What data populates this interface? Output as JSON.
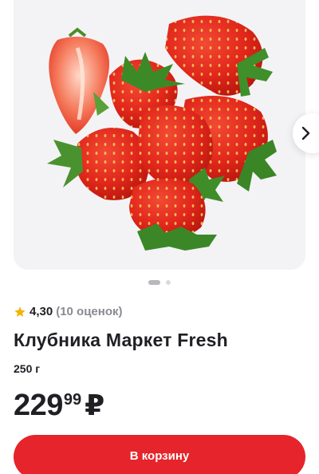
{
  "product": {
    "rating_value": "4,30",
    "rating_count": "(10 оценок)",
    "title": "Клубника Маркет Fresh",
    "weight": "250 г",
    "price_integer": "229",
    "price_fraction": "99",
    "currency": "₽"
  },
  "gallery": {
    "image": "strawberries-photo",
    "slides_total": 2,
    "active_slide": 1,
    "next_icon": "chevron-right-icon"
  },
  "actions": {
    "add_to_cart_label": "В корзину"
  },
  "colors": {
    "accent": "#e5242b",
    "star": "#f5b301",
    "gallery_bg": "#f3f3f5"
  }
}
